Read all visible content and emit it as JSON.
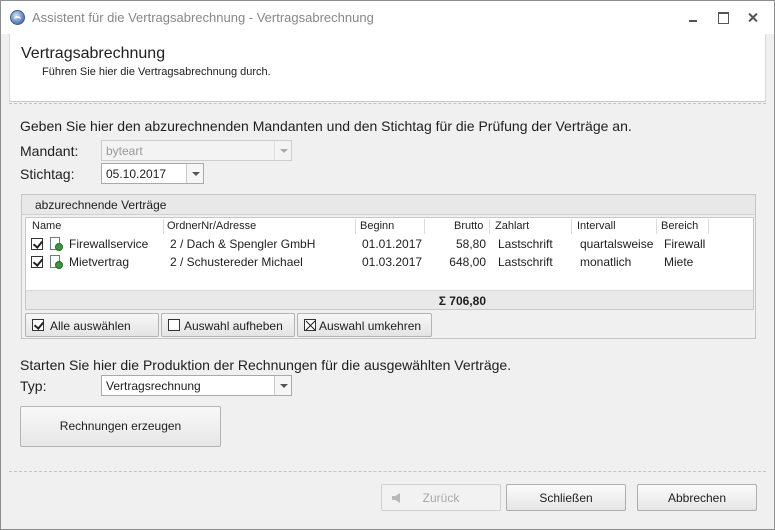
{
  "window": {
    "title": "Assistent für die Vertragsabrechnung - Vertragsabrechnung"
  },
  "header": {
    "title": "Vertragsabrechnung",
    "subtitle": "Führen Sie hier die Vertragsabrechnung durch."
  },
  "form": {
    "intro": "Geben Sie hier den abzurechnenden Mandanten und den Stichtag für die Prüfung der Verträge an.",
    "mandant_label": "Mandant:",
    "mandant_value": "byteart",
    "stichtag_label": "Stichtag:",
    "stichtag_value": "05.10.2017"
  },
  "contracts": {
    "group_title": "abzurechnende Verträge",
    "columns": [
      "Name",
      "OrdnerNr/Adresse",
      "Beginn",
      "Brutto",
      "Zahlart",
      "Intervall",
      "Bereich"
    ],
    "rows": [
      {
        "checked": true,
        "name": "Firewallservice",
        "adresse": "2 / Dach & Spengler GmbH",
        "beginn": "01.01.2017",
        "brutto": "58,80",
        "zahlart": "Lastschrift",
        "intervall": "quartalsweise",
        "bereich": "Firewall"
      },
      {
        "checked": true,
        "name": "Mietvertrag",
        "adresse": "2 / Schustereder Michael",
        "beginn": "01.03.2017",
        "brutto": "648,00",
        "zahlart": "Lastschrift",
        "intervall": "monatlich",
        "bereich": "Miete"
      }
    ],
    "total": "Σ 706,80",
    "select_all": "Alle auswählen",
    "deselect": "Auswahl aufheben",
    "invert": "Auswahl umkehren"
  },
  "production": {
    "intro": "Starten Sie hier die Produktion der Rechnungen für die ausgewählten Verträge.",
    "typ_label": "Typ:",
    "typ_value": "Vertragsrechnung",
    "generate_button": "Rechnungen erzeugen"
  },
  "footer": {
    "back": "Zurück",
    "close": "Schließen",
    "cancel": "Abbrechen"
  }
}
